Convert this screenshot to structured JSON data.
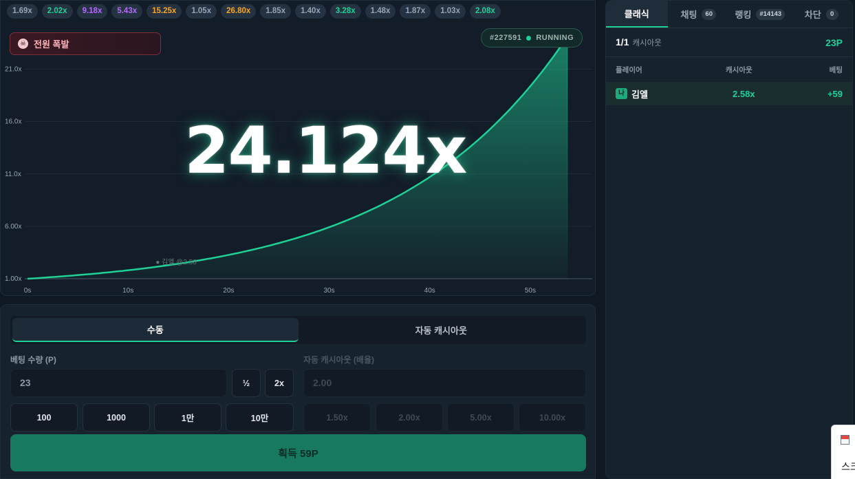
{
  "history": [
    {
      "value": "1.69x",
      "color": "#98a4b2"
    },
    {
      "value": "2.02x",
      "color": "#1fd196"
    },
    {
      "value": "9.18x",
      "color": "#b36bff"
    },
    {
      "value": "5.43x",
      "color": "#b36bff"
    },
    {
      "value": "15.25x",
      "color": "#f4a62a"
    },
    {
      "value": "1.05x",
      "color": "#98a4b2"
    },
    {
      "value": "26.80x",
      "color": "#f4a62a"
    },
    {
      "value": "1.85x",
      "color": "#98a4b2"
    },
    {
      "value": "1.40x",
      "color": "#98a4b2"
    },
    {
      "value": "3.28x",
      "color": "#1fd196"
    },
    {
      "value": "1.48x",
      "color": "#98a4b2"
    },
    {
      "value": "1.87x",
      "color": "#98a4b2"
    },
    {
      "value": "1.03x",
      "color": "#98a4b2"
    },
    {
      "value": "2.08x",
      "color": "#1fd196"
    }
  ],
  "game": {
    "crash_badge": "전원 폭발",
    "round_id": "#227591",
    "status": "RUNNING",
    "multiplier": "24.124x",
    "cashout_marker": "● 김엘 @2.58"
  },
  "chart_data": {
    "type": "line",
    "xlabel": "",
    "ylabel": "",
    "x_ticks": [
      "0s",
      "10s",
      "20s",
      "30s",
      "40s",
      "50s"
    ],
    "y_ticks": [
      "1.00x",
      "6.00x",
      "11.0x",
      "16.0x",
      "21.0x"
    ],
    "xlim": [
      0,
      53.7
    ],
    "ylim": [
      1,
      24.124
    ],
    "series": [
      {
        "end_x": 53.7,
        "end_y": 24.124
      }
    ],
    "cashout_point": {
      "x": 16.5,
      "y": 2.58
    }
  },
  "bet": {
    "tabs": [
      "수동",
      "자동 캐시아웃"
    ],
    "active_tab": 0,
    "amount_label": "베팅 수량 (P)",
    "amount_value": "23",
    "half_label": "½",
    "double_label": "2x",
    "presets": [
      "100",
      "1000",
      "1만",
      "10만"
    ],
    "auto_label": "자동 캐시아웃 (배율)",
    "auto_value": "2.00",
    "auto_presets": [
      "1.50x",
      "2.00x",
      "5.00x",
      "10.00x"
    ],
    "cashout_button": "획득 59P"
  },
  "side": {
    "tabs": [
      {
        "label": "클래식",
        "badge": ""
      },
      {
        "label": "채팅",
        "badge": "60"
      },
      {
        "label": "랭킹",
        "badge": "#14143"
      },
      {
        "label": "차단",
        "badge": "0"
      }
    ],
    "summary_count": "1/1",
    "summary_label": "캐시아웃",
    "summary_total": "23P",
    "columns": [
      "플레이어",
      "캐시아웃",
      "베팅"
    ],
    "rows": [
      {
        "tag": "나",
        "player": "김엘",
        "cashout": "2.58x",
        "bet": "+59"
      }
    ]
  },
  "popup": {
    "text": "스크"
  }
}
